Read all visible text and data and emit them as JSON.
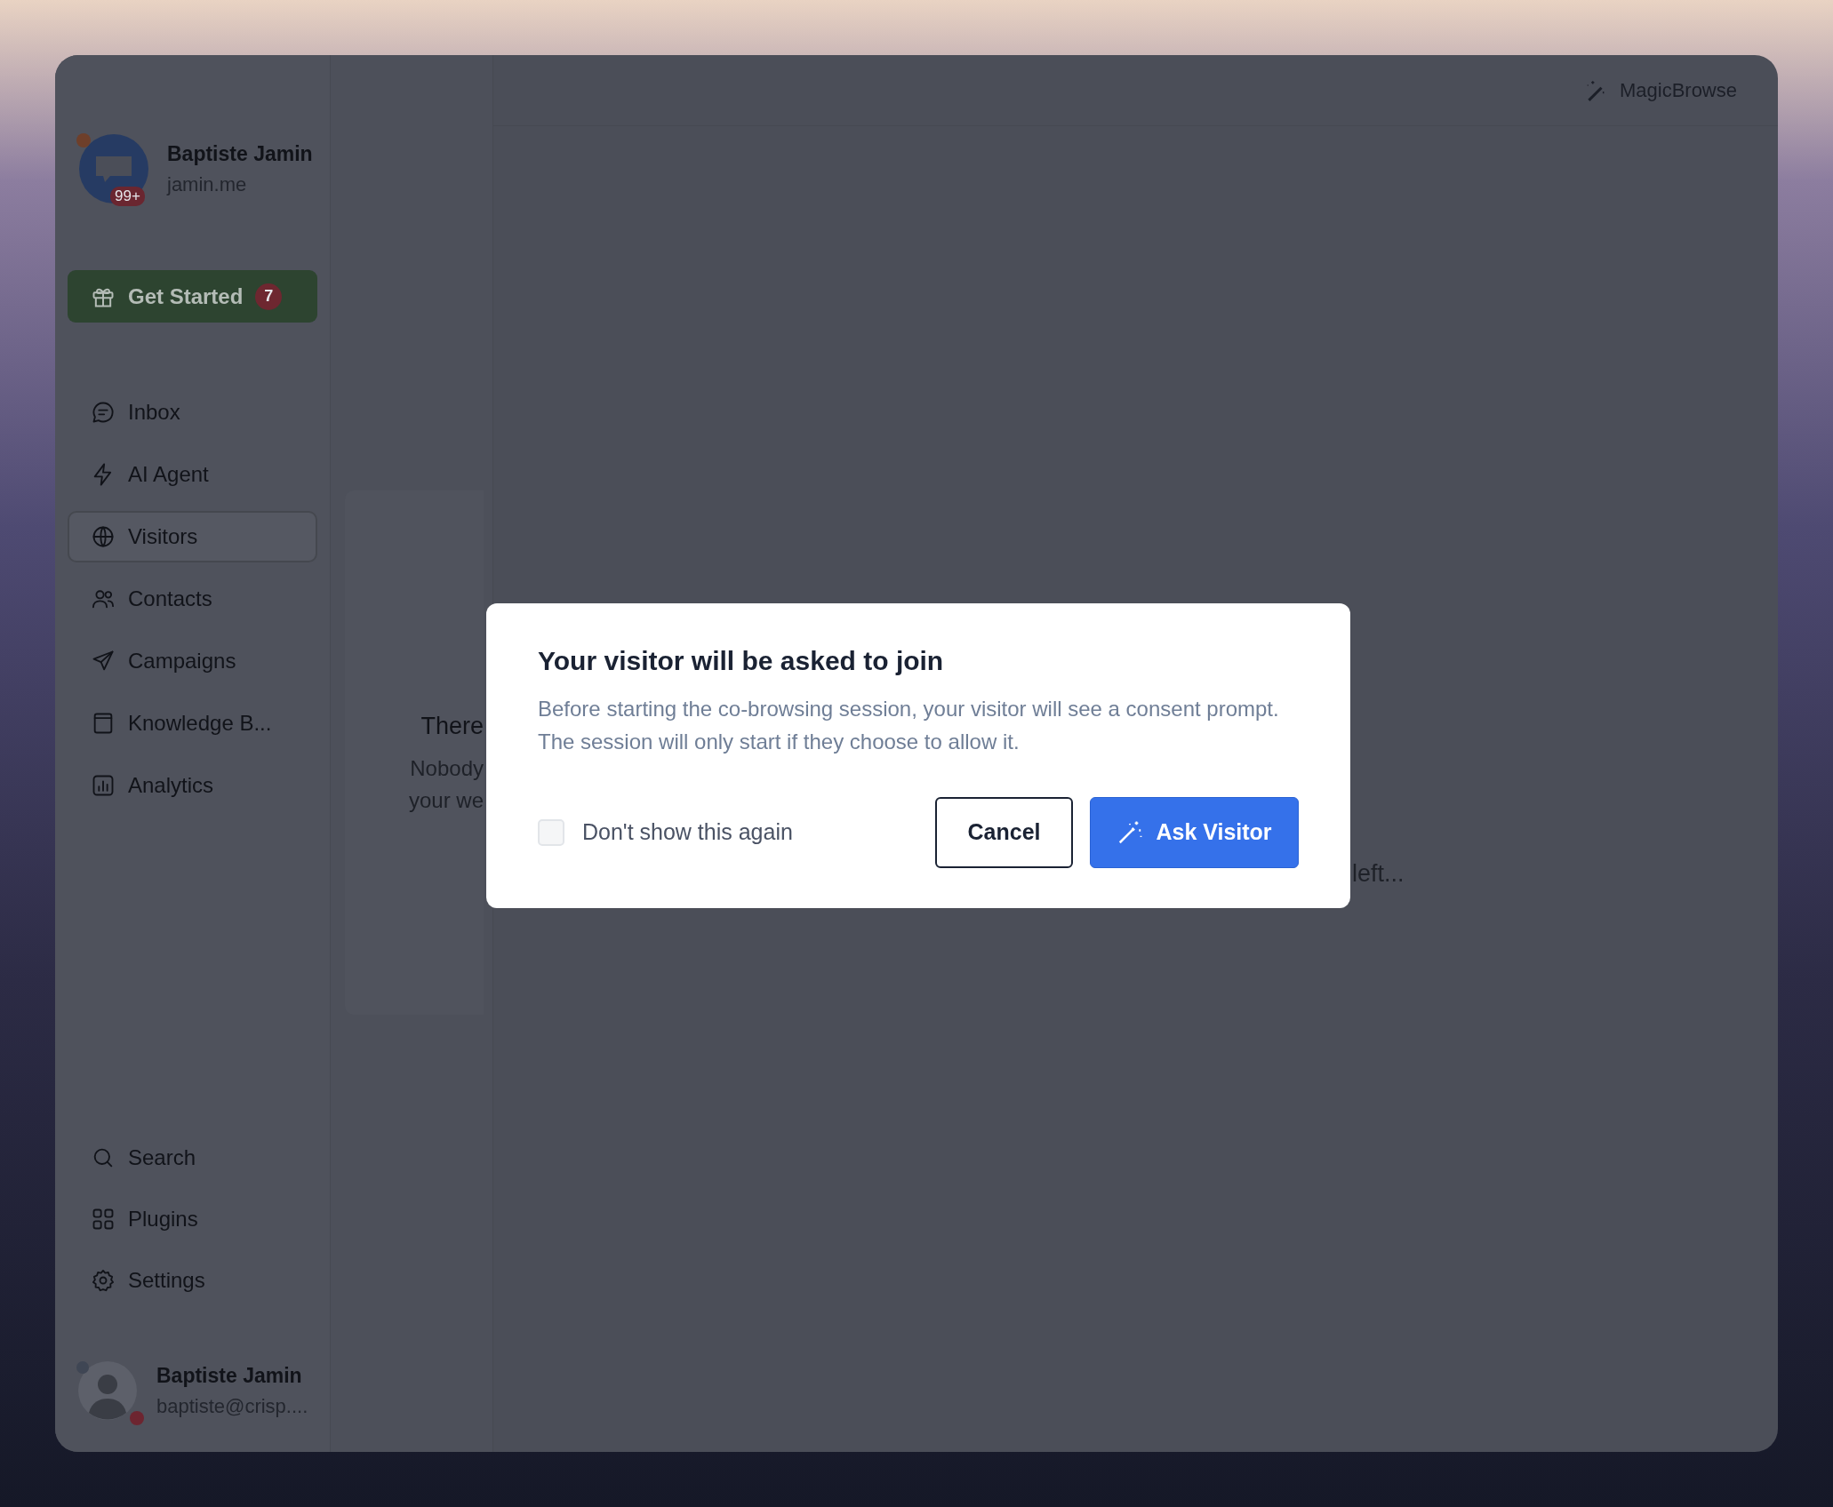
{
  "sidebar": {
    "account": {
      "name": "Baptiste Jamin",
      "domain": "jamin.me",
      "badge": "99+"
    },
    "get_started": {
      "label": "Get Started",
      "count": "7"
    },
    "nav_items": [
      {
        "label": "Inbox",
        "kind": "chat",
        "selected": false
      },
      {
        "label": "AI Agent",
        "kind": "bolt",
        "selected": false
      },
      {
        "label": "Visitors",
        "kind": "globe",
        "selected": true
      },
      {
        "label": "Contacts",
        "kind": "people",
        "selected": false
      },
      {
        "label": "Campaigns",
        "kind": "send",
        "selected": false
      },
      {
        "label": "Knowledge B...",
        "kind": "book",
        "selected": false
      },
      {
        "label": "Analytics",
        "kind": "chart",
        "selected": false
      }
    ],
    "bottom_items": [
      {
        "label": "Search",
        "kind": "search",
        "selected": false
      },
      {
        "label": "Plugins",
        "kind": "grid",
        "selected": false
      },
      {
        "label": "Settings",
        "kind": "gear",
        "selected": false
      }
    ],
    "user": {
      "name": "Baptiste Jamin",
      "email": "baptiste@crisp...."
    }
  },
  "middle_panel": {
    "title": "There",
    "lines": [
      "Nobody",
      "your we"
    ]
  },
  "main": {
    "top_link": "MagicBrowse",
    "hint": "left..."
  },
  "dialog": {
    "title": "Your visitor will be asked to join",
    "message": "Before starting the co-browsing session, your visitor will see a consent prompt. The session will only start if they choose to allow it.",
    "checkbox": {
      "label": "Don't show this again",
      "checked": false
    },
    "buttons": [
      {
        "label": "Cancel",
        "kind": "secondary"
      },
      {
        "label": "Ask Visitor",
        "kind": "primary"
      }
    ]
  }
}
